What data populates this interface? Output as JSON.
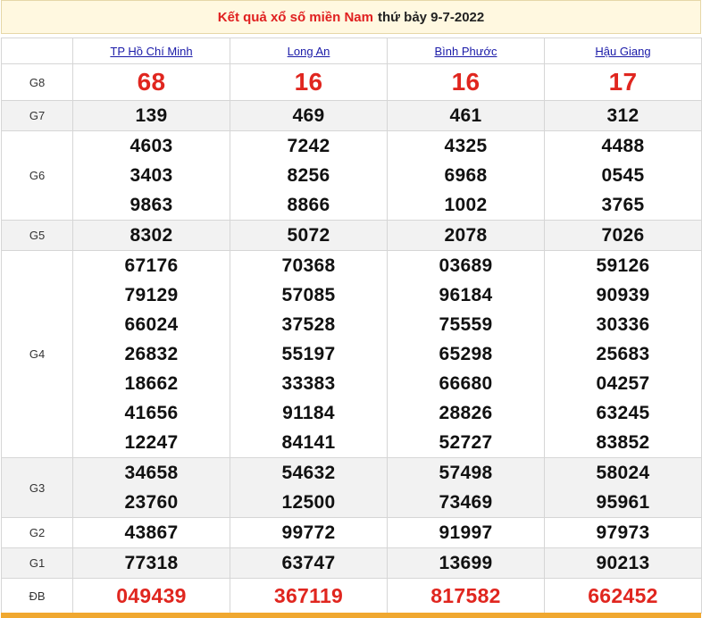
{
  "header": {
    "link_text": "Kết quả xổ số miền Nam",
    "date_text": "thứ bảy 9-7-2022"
  },
  "provinces": [
    "TP Hồ Chí Minh",
    "Long An",
    "Bình Phước",
    "Hậu Giang"
  ],
  "prizes": [
    {
      "label": "G8",
      "results": [
        [
          "68"
        ],
        [
          "16"
        ],
        [
          "16"
        ],
        [
          "17"
        ]
      ]
    },
    {
      "label": "G7",
      "results": [
        [
          "139"
        ],
        [
          "469"
        ],
        [
          "461"
        ],
        [
          "312"
        ]
      ]
    },
    {
      "label": "G6",
      "results": [
        [
          "4603",
          "3403",
          "9863"
        ],
        [
          "7242",
          "8256",
          "8866"
        ],
        [
          "4325",
          "6968",
          "1002"
        ],
        [
          "4488",
          "0545",
          "3765"
        ]
      ]
    },
    {
      "label": "G5",
      "results": [
        [
          "8302"
        ],
        [
          "5072"
        ],
        [
          "2078"
        ],
        [
          "7026"
        ]
      ]
    },
    {
      "label": "G4",
      "results": [
        [
          "67176",
          "79129",
          "66024",
          "26832",
          "18662",
          "41656",
          "12247"
        ],
        [
          "70368",
          "57085",
          "37528",
          "55197",
          "33383",
          "91184",
          "84141"
        ],
        [
          "03689",
          "96184",
          "75559",
          "65298",
          "66680",
          "28826",
          "52727"
        ],
        [
          "59126",
          "90939",
          "30336",
          "25683",
          "04257",
          "63245",
          "83852"
        ]
      ]
    },
    {
      "label": "G3",
      "results": [
        [
          "34658",
          "23760"
        ],
        [
          "54632",
          "12500"
        ],
        [
          "57498",
          "73469"
        ],
        [
          "58024",
          "95961"
        ]
      ]
    },
    {
      "label": "G2",
      "results": [
        [
          "43867"
        ],
        [
          "99772"
        ],
        [
          "91997"
        ],
        [
          "97973"
        ]
      ]
    },
    {
      "label": "G1",
      "results": [
        [
          "77318"
        ],
        [
          "63747"
        ],
        [
          "13699"
        ],
        [
          "90213"
        ]
      ]
    },
    {
      "label": "ĐB",
      "results": [
        [
          "049439"
        ],
        [
          "367119"
        ],
        [
          "817582"
        ],
        [
          "662452"
        ]
      ]
    }
  ],
  "colors": {
    "accent_red": "#e0261f",
    "link_blue": "#1a1aa8",
    "title_bg": "#fff8e0",
    "bar_orange": "#f0a830"
  }
}
